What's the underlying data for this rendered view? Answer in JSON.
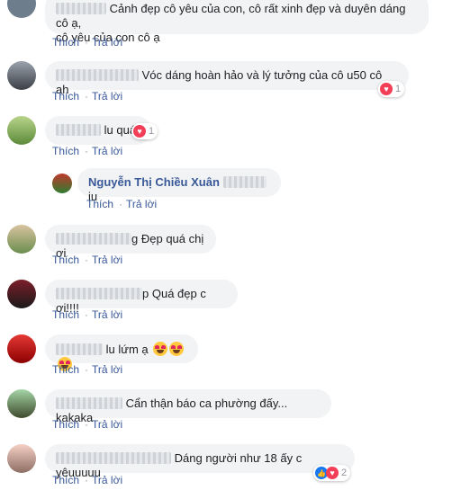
{
  "actions": {
    "like": "Thích",
    "reply": "Trả lời",
    "sep": "·"
  },
  "comments": [
    {
      "text": "Cảnh đẹp cô yêu của con, cô rất xinh đẹp và duyên dáng cô ạ,",
      "text2": "cô yêu của con cô ạ"
    },
    {
      "text": "Vóc dáng hoàn hảo và lý tưởng của cô u50 cô ah",
      "reactions": "1"
    },
    {
      "text": "lu quá",
      "reactions": "1"
    },
    {
      "reply_name": "Nguyễn Thị Chiều Xuân",
      "text": "iu"
    },
    {
      "text": "Đẹp quá chị ơi",
      "prefix_tail": "g"
    },
    {
      "text": "Quá đẹp c ơi!!!!",
      "prefix_tail": "p"
    },
    {
      "text": "lu lứm ạ"
    },
    {
      "text": "Cẩn thận báo ca phường đấy... kakaka"
    },
    {
      "text": "Dáng người như 18 ấy c yêuuuuu",
      "reactions": "2"
    }
  ],
  "colors": {
    "link": "#385898",
    "bubble": "#f2f3f5",
    "heart": "#f33e58",
    "like": "#1877f2"
  }
}
